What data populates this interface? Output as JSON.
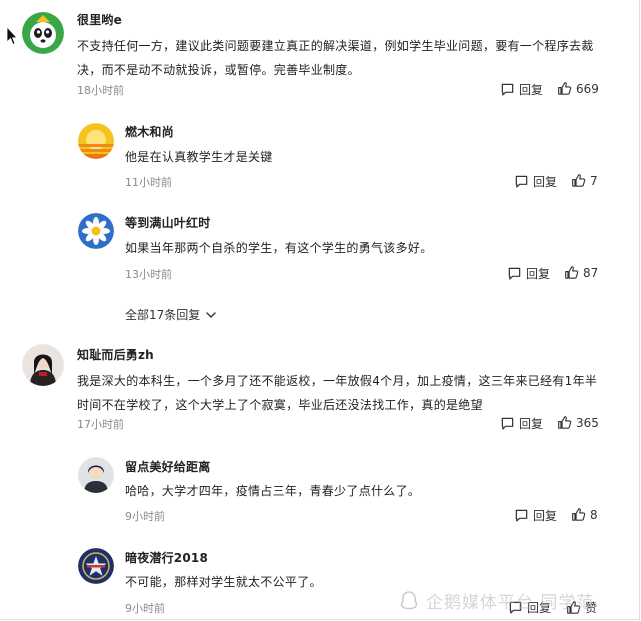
{
  "comments": [
    {
      "user": "很里哟e",
      "text": "不支持任何一方，建议此类问题要建立真正的解决渠道，例如学生毕业问题，要有一个程序去裁决，而不是动不动就投诉，或暂停。完善毕业制度。",
      "time": "18小时前",
      "reply_label": "回复",
      "likes": "669",
      "replies": [
        {
          "user": "燃木和尚",
          "text": "他是在认真教学生才是关键",
          "time": "11小时前",
          "reply_label": "回复",
          "likes": "7"
        },
        {
          "user": "等到满山叶红时",
          "text": "如果当年那两个自杀的学生，有这个学生的勇气该多好。",
          "time": "13小时前",
          "reply_label": "回复",
          "likes": "87"
        }
      ],
      "more_replies": "全部17条回复"
    },
    {
      "user": "知耻而后勇zh",
      "text": "我是深大的本科生，一个多月了还不能返校，一年放假4个月，加上疫情，这三年来已经有1年半时间不在学校了，这个大学上了个寂寞，毕业后还没法找工作，真的是绝望",
      "time": "17小时前",
      "reply_label": "回复",
      "likes": "365",
      "replies": [
        {
          "user": "留点美好给距离",
          "text": "哈哈，大学才四年，疫情占三年，青春少了点什么了。",
          "time": "9小时前",
          "reply_label": "回复",
          "likes": "8"
        },
        {
          "user": "暗夜潜行2018",
          "text": "不可能，那样对学生就太不公平了。",
          "time": "9小时前",
          "reply_label": "回复",
          "likes": "赞"
        }
      ]
    }
  ],
  "watermark": "企鹅媒体平台 同学范",
  "icons": {
    "reply": "reply-bubble-icon",
    "like": "thumbs-up-icon",
    "expand": "chevron-down-icon",
    "cursor": "mouse-pointer-icon"
  },
  "colors": {
    "text": "#222222",
    "muted": "#8a8a8a",
    "background": "#ffffff"
  }
}
